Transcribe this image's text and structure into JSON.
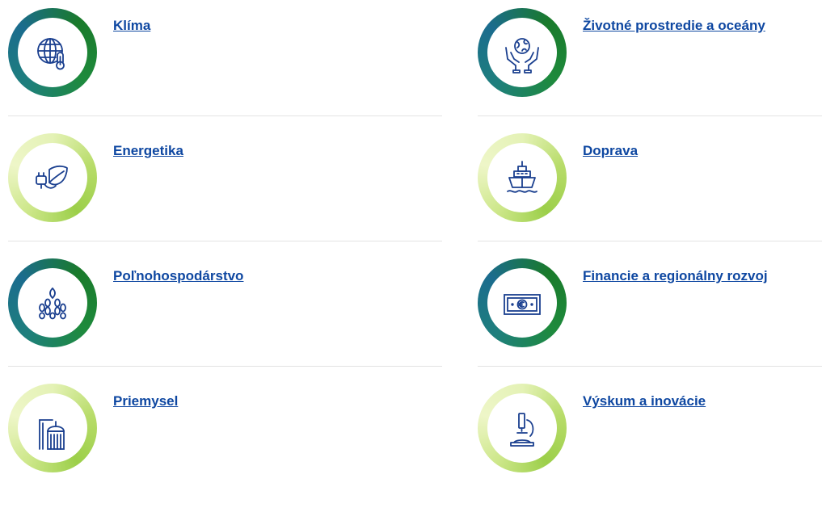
{
  "topics": {
    "left": [
      {
        "title": "Klíma",
        "icon": "globe-thermometer-icon",
        "ring": "dark"
      },
      {
        "title": "Energetika",
        "icon": "plug-leaf-icon",
        "ring": "light"
      },
      {
        "title": "Poľnohospodárstvo",
        "icon": "wheat-icon",
        "ring": "dark"
      },
      {
        "title": "Priemysel",
        "icon": "industry-tank-icon",
        "ring": "light"
      }
    ],
    "right": [
      {
        "title": "Životné prostredie a oceány",
        "icon": "hands-globe-icon",
        "ring": "dark"
      },
      {
        "title": "Doprava",
        "icon": "ship-icon",
        "ring": "light"
      },
      {
        "title": "Financie a regionálny rozvoj",
        "icon": "euro-banknote-icon",
        "ring": "dark"
      },
      {
        "title": "Výskum a inovácie",
        "icon": "microscope-icon",
        "ring": "light"
      }
    ]
  },
  "colors": {
    "link": "#0e47a1",
    "icon_stroke": "#1a3f8f",
    "ring_dark": "#1a7a2b",
    "ring_light": "#b8dc6a",
    "divider": "#e3e3e3"
  }
}
